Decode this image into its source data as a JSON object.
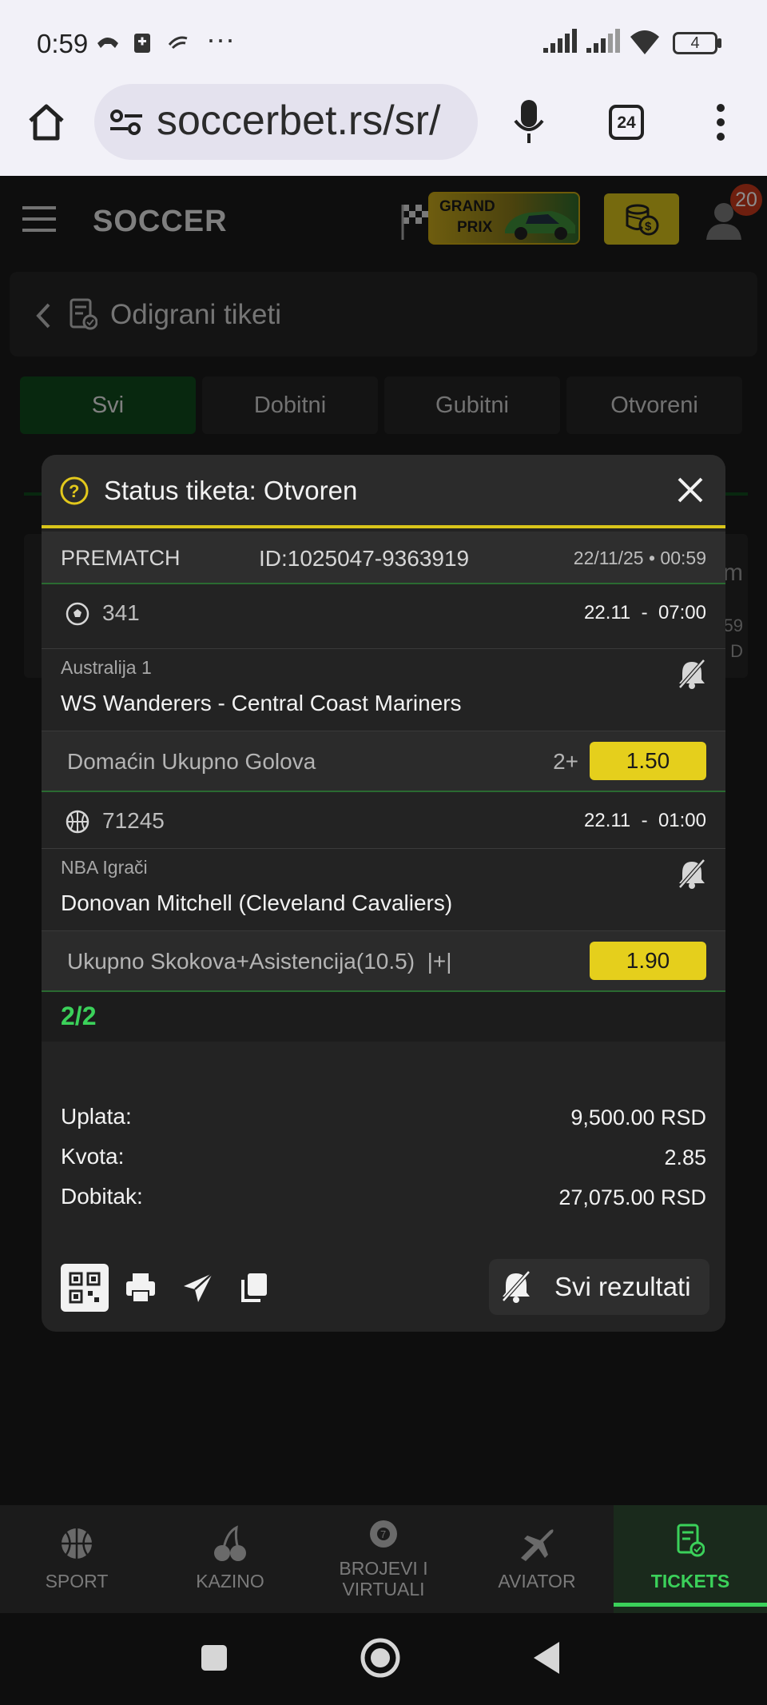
{
  "status_bar": {
    "time": "0:59",
    "battery": "4"
  },
  "browser": {
    "url": "soccerbet.rs/sr/",
    "tab_count": "24"
  },
  "header": {
    "logo": "SOCCER",
    "promo_line1": "GRAND",
    "promo_line2": "PRIX",
    "notification_count": "20"
  },
  "page": {
    "title": "Odigrani tiketi"
  },
  "filter_tabs": [
    {
      "label": "Svi"
    },
    {
      "label": "Dobitni"
    },
    {
      "label": "Gubitni"
    },
    {
      "label": "Otvoreni"
    }
  ],
  "background_fragments": {
    "right_a": "m",
    "right_b": "59",
    "right_c": "D"
  },
  "modal": {
    "title": "Status tiketa: Otvoren",
    "ticket_type": "PREMATCH",
    "ticket_id": "ID:1025047-9363919",
    "ticket_datetime": "22/11/25 • 00:59",
    "events": [
      {
        "code": "341",
        "date": "22.11  -  07:00",
        "league": "Australija 1",
        "match": "WS Wanderers - Central Coast Mariners",
        "market": "Domaćin Ukupno Golova",
        "pick": "2+",
        "odd": "1.50"
      },
      {
        "code": "71245",
        "date": "22.11  -  01:00",
        "league": "NBA Igrači",
        "match": "Donovan Mitchell (Cleveland Cavaliers)",
        "market": "Ukupno Skokova+Asistencija(10.5)  |+|",
        "pick": "",
        "odd": "1.90"
      }
    ],
    "combination": "2/2",
    "summary": {
      "stake_label": "Uplata:",
      "stake_value": "9,500.00 RSD",
      "odds_label": "Kvota:",
      "odds_value": "2.85",
      "win_label": "Dobitak:",
      "win_value": "27,075.00 RSD"
    },
    "all_results_label": "Svi rezultati"
  },
  "bottom_nav": [
    {
      "label": "SPORT"
    },
    {
      "label": "KAZINO"
    },
    {
      "label": "BROJEVI I VIRTUALI"
    },
    {
      "label": "AVIATOR"
    },
    {
      "label": "TICKETS"
    }
  ],
  "colors": {
    "accent_green": "#3bd15a",
    "odd_yellow": "#e5cf1c",
    "active_tab": "#0f4a1c"
  }
}
